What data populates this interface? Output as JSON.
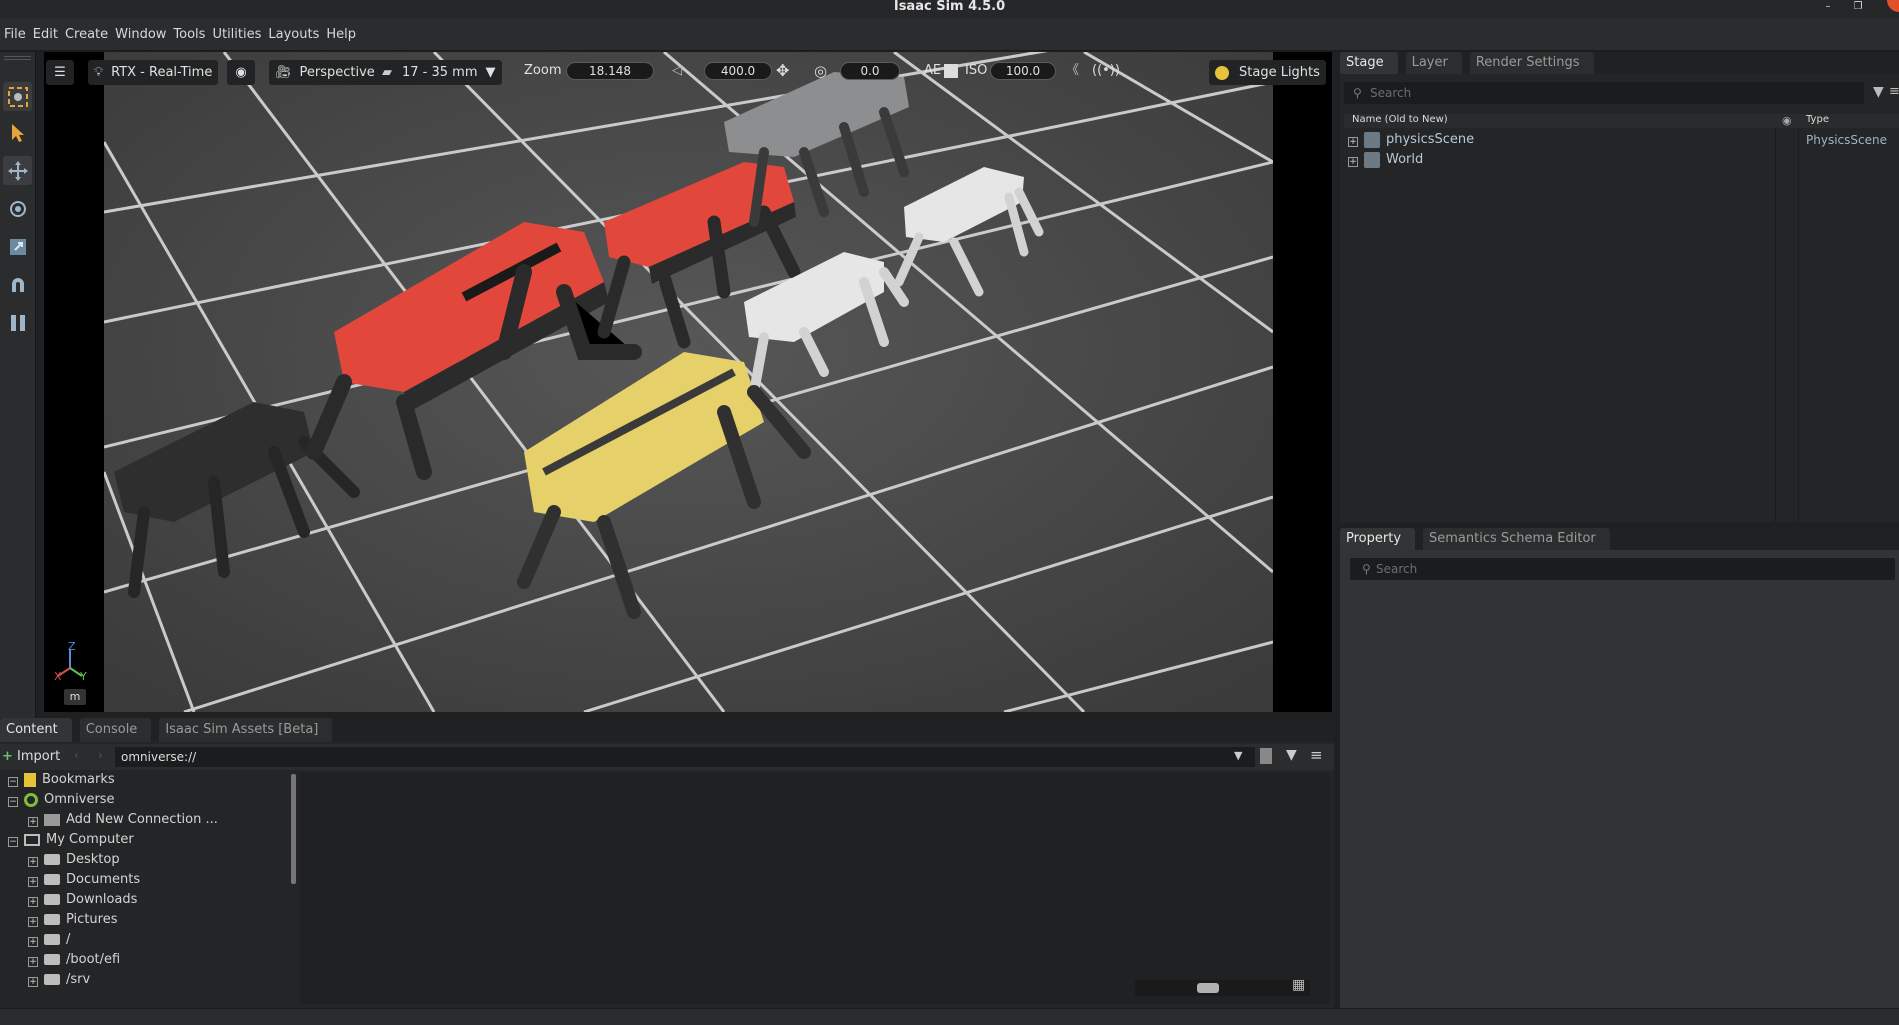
{
  "window": {
    "title": "Isaac Sim 4.5.0"
  },
  "menu": [
    "File",
    "Edit",
    "Create",
    "Window",
    "Tools",
    "Utilities",
    "Layouts",
    "Help"
  ],
  "viewport_toolbar": {
    "renderer": "RTX - Real-Time",
    "camera": "Perspective",
    "lens": "17 - 35 mm",
    "zoom_label": "Zoom",
    "zoom_value": "18.148",
    "speed_value": "400.0",
    "angle_value": "0.0",
    "ae_label": "AE",
    "iso_label": "ISO",
    "iso_value": "100.0",
    "lights": "Stage Lights"
  },
  "viewport": {
    "axis_z": "Z",
    "axis_x": "X",
    "axis_y": "Y",
    "unit": "m"
  },
  "stage": {
    "tabs": [
      "Stage",
      "Layer",
      "Render Settings"
    ],
    "search_placeholder": "Search",
    "col_name": "Name (Old to New)",
    "col_type": "Type",
    "rows": [
      {
        "name": "physicsScene",
        "type": "PhysicsScene"
      },
      {
        "name": "World",
        "type": ""
      }
    ]
  },
  "property": {
    "tabs": [
      "Property",
      "Semantics Schema Editor"
    ],
    "search_placeholder": "Search"
  },
  "content": {
    "tabs": [
      "Content",
      "Console",
      "Isaac Sim Assets [Beta]"
    ],
    "import_label": "Import",
    "path": "omniverse://",
    "tree": [
      {
        "label": "Bookmarks",
        "level": 0,
        "icon": "bookmark-icon"
      },
      {
        "label": "Omniverse",
        "level": 0,
        "icon": "omniverse-icon"
      },
      {
        "label": "Add New Connection ...",
        "level": 1,
        "icon": "connection-icon"
      },
      {
        "label": "My Computer",
        "level": 0,
        "icon": "computer-icon"
      },
      {
        "label": "Desktop",
        "level": 1,
        "icon": "drive-icon"
      },
      {
        "label": "Documents",
        "level": 1,
        "icon": "drive-icon"
      },
      {
        "label": "Downloads",
        "level": 1,
        "icon": "drive-icon"
      },
      {
        "label": "Pictures",
        "level": 1,
        "icon": "drive-icon"
      },
      {
        "label": "/",
        "level": 1,
        "icon": "drive-icon"
      },
      {
        "label": "/boot/efi",
        "level": 1,
        "icon": "drive-icon"
      },
      {
        "label": "/srv",
        "level": 1,
        "icon": "drive-icon"
      }
    ]
  },
  "colors": {
    "accent_orange": "#e8a33a",
    "robot_red": "#e2473c",
    "robot_yellow": "#e6d06a",
    "floor": "#4a4a4a",
    "grid": "#d8d8d8"
  }
}
